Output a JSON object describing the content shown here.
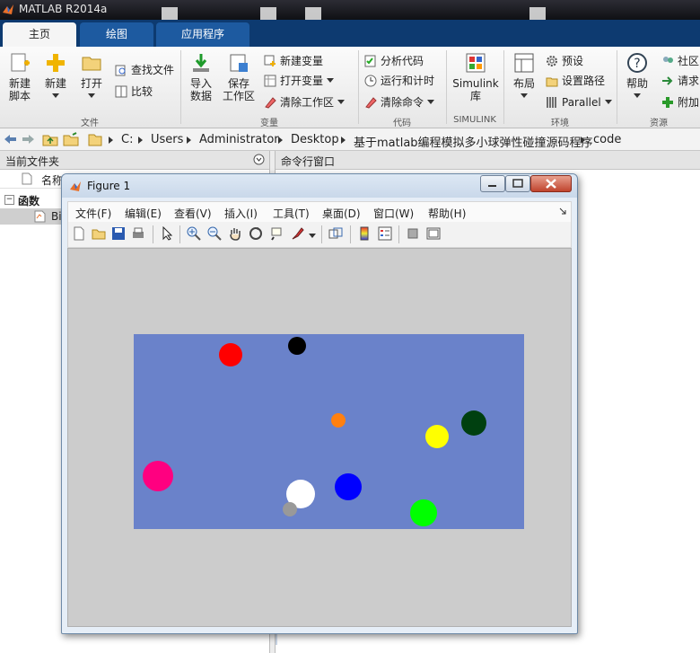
{
  "window": {
    "title": "MATLAB R2014a"
  },
  "tabs": [
    "主页",
    "绘图",
    "应用程序"
  ],
  "ribbon": {
    "file": {
      "new_script": [
        "新建",
        "脚本"
      ],
      "new": "新建",
      "open": "打开",
      "find_files": "查找文件",
      "compare": "比较",
      "group": "文件"
    },
    "variable": {
      "import": [
        "导入",
        "数据"
      ],
      "save": [
        "保存",
        "工作区"
      ],
      "new_var": "新建变量",
      "open_var": "打开变量",
      "clear_ws": "清除工作区",
      "group": "变量"
    },
    "code": {
      "analyze": "分析代码",
      "run_time": "运行和计时",
      "clear_cmd": "清除命令",
      "group": "代码"
    },
    "simulink": {
      "label": [
        "Simulink",
        "库"
      ],
      "group": "SIMULINK"
    },
    "env": {
      "layout": "布局",
      "prefs": "预设",
      "set_path": "设置路径",
      "parallel": "Parallel",
      "group": "环境"
    },
    "resources": {
      "help": "帮助",
      "community": "社区",
      "request": "请求",
      "addons": "附加",
      "group": "资源"
    }
  },
  "address": [
    "C:",
    "Users",
    "Administrator",
    "Desktop",
    "基于matlab编程模拟多小球弹性碰撞源码程序",
    "code"
  ],
  "left_panel": {
    "title": "当前文件夹",
    "col_name": "名称",
    "group_label": "函数",
    "file_prefix": "Bi"
  },
  "command_window": {
    "title": "命令行窗口"
  },
  "figure": {
    "title": "Figure 1",
    "menu": [
      "文件(F)",
      "编辑(E)",
      "查看(V)",
      "插入(I)",
      "工具(T)",
      "桌面(D)",
      "窗口(W)",
      "帮助(H)"
    ],
    "table_color": "#6a82ca",
    "balls": [
      {
        "color": "#ff0000",
        "r": 13
      },
      {
        "color": "#000000",
        "r": 10
      },
      {
        "color": "#ff8010",
        "r": 8
      },
      {
        "color": "#ffff00",
        "r": 13
      },
      {
        "color": "#004010",
        "r": 14
      },
      {
        "color": "#ff0080",
        "r": 17
      },
      {
        "color": "#ffffff",
        "r": 16
      },
      {
        "color": "#999999",
        "r": 8
      },
      {
        "color": "#0000ff",
        "r": 15
      },
      {
        "color": "#00ff00",
        "r": 15
      }
    ]
  }
}
